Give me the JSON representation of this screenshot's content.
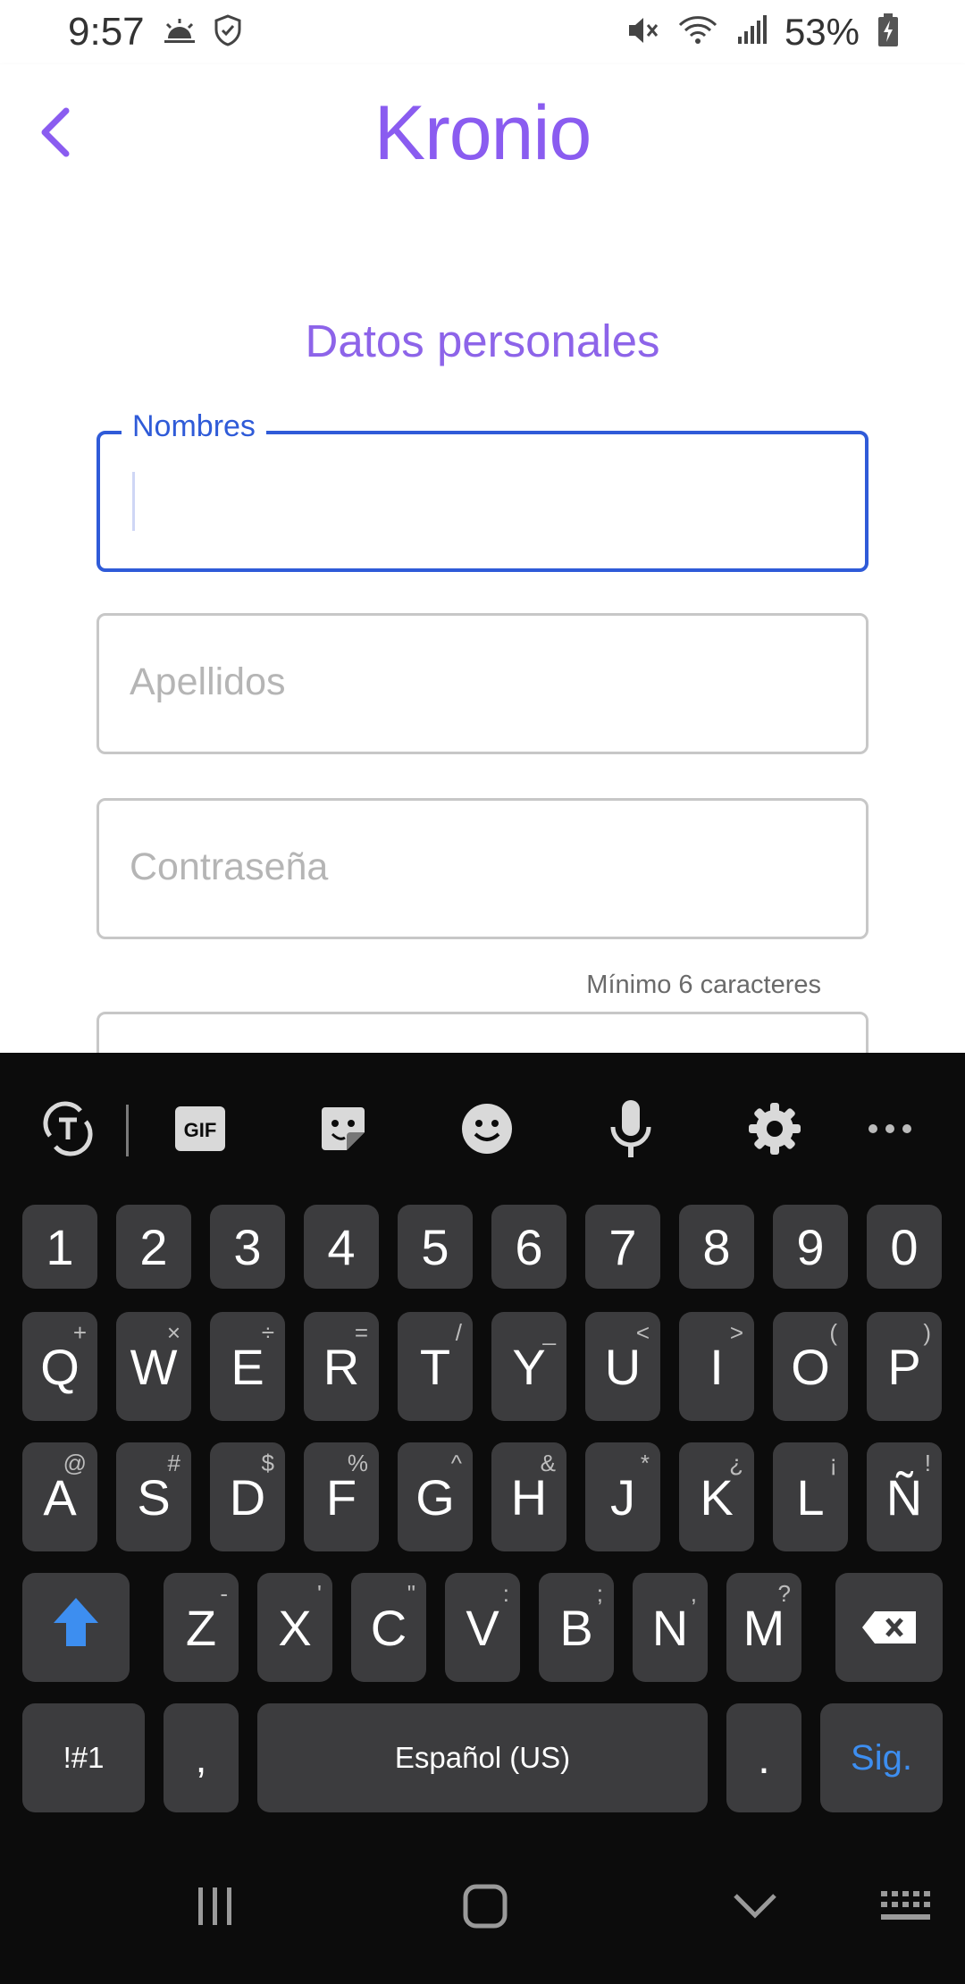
{
  "status_bar": {
    "time": "9:57",
    "battery_percent": "53%",
    "icons": [
      "weather-icon",
      "shield-icon",
      "mute-icon",
      "wifi-icon",
      "signal-icon",
      "battery-charging-icon"
    ]
  },
  "app_bar": {
    "brand": "Kronio",
    "back_icon": "chevron-left-icon",
    "accent_color": "#8a5cf0"
  },
  "form": {
    "title": "Datos personales",
    "fields": [
      {
        "label": "Nombres",
        "value": "",
        "focused": true
      },
      {
        "placeholder": "Apellidos",
        "value": ""
      },
      {
        "placeholder": "Contraseña",
        "value": ""
      }
    ],
    "password_hint": "Mínimo 6 caracteres",
    "focus_color": "#2f5bd8"
  },
  "keyboard": {
    "toolbar": [
      "text-tools-icon",
      "gif-icon",
      "sticker-icon",
      "emoji-icon",
      "microphone-icon",
      "settings-icon",
      "more-icon"
    ],
    "toolbar_gif_label": "GIF",
    "rows": {
      "numbers": [
        "1",
        "2",
        "3",
        "4",
        "5",
        "6",
        "7",
        "8",
        "9",
        "0"
      ],
      "row1": [
        {
          "k": "Q",
          "s": "+"
        },
        {
          "k": "W",
          "s": "×"
        },
        {
          "k": "E",
          "s": "÷"
        },
        {
          "k": "R",
          "s": "="
        },
        {
          "k": "T",
          "s": "/"
        },
        {
          "k": "Y",
          "s": "_"
        },
        {
          "k": "U",
          "s": "<"
        },
        {
          "k": "I",
          "s": ">"
        },
        {
          "k": "O",
          "s": "("
        },
        {
          "k": "P",
          "s": ")"
        }
      ],
      "row2": [
        {
          "k": "A",
          "s": "@"
        },
        {
          "k": "S",
          "s": "#"
        },
        {
          "k": "D",
          "s": "$"
        },
        {
          "k": "F",
          "s": "%"
        },
        {
          "k": "G",
          "s": "^"
        },
        {
          "k": "H",
          "s": "&"
        },
        {
          "k": "J",
          "s": "*"
        },
        {
          "k": "K",
          "s": "¿"
        },
        {
          "k": "L",
          "s": "¡"
        },
        {
          "k": "Ñ",
          "s": "!"
        }
      ],
      "row3": [
        {
          "k": "Z",
          "s": "-"
        },
        {
          "k": "X",
          "s": "'"
        },
        {
          "k": "C",
          "s": "\""
        },
        {
          "k": "V",
          "s": ":"
        },
        {
          "k": "B",
          "s": ";"
        },
        {
          "k": "N",
          "s": ","
        },
        {
          "k": "M",
          "s": "?"
        }
      ]
    },
    "symbols_key": "!#1",
    "comma_key": ",",
    "space_label": "Español (US)",
    "period_key": ".",
    "action_key": "Sig.",
    "action_color": "#3d8ef0"
  },
  "nav_bar": {
    "buttons": [
      "recent-apps-icon",
      "home-icon",
      "hide-keyboard-icon",
      "keyboard-switch-icon"
    ]
  }
}
